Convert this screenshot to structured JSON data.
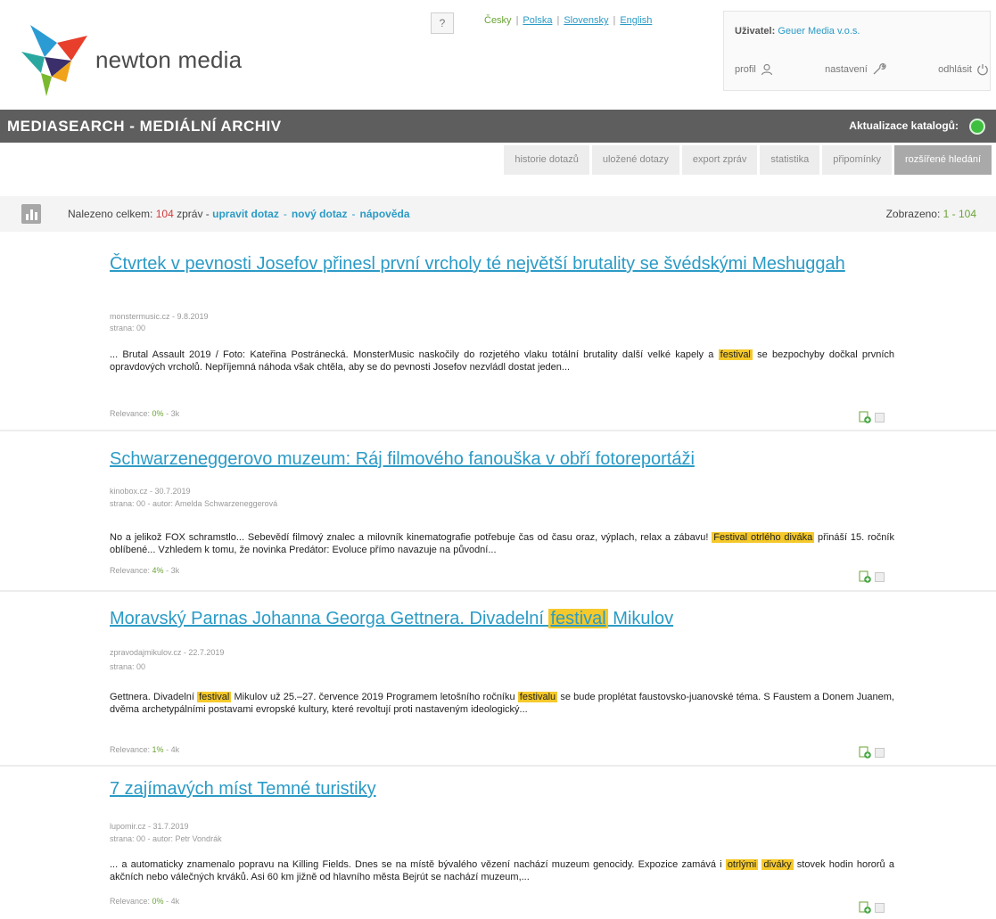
{
  "brand": {
    "name": "newton media"
  },
  "header": {
    "help_label": "?",
    "languages": [
      {
        "label": "Česky",
        "active": true
      },
      {
        "label": "Polska",
        "active": false
      },
      {
        "label": "Slovensky",
        "active": false
      },
      {
        "label": "English",
        "active": false
      }
    ],
    "user": {
      "label": "Uživatel:",
      "value": "Geuer Media v.o.s.",
      "profile_label": "profil",
      "settings_label": "nastavení",
      "logout_label": "odhlásit"
    }
  },
  "titlebar": {
    "title": "MEDIASEARCH - MEDIÁLNÍ ARCHIV",
    "catalog_label": "Aktualizace katalogů:",
    "status_color": "#3fbf3f"
  },
  "tabs": [
    {
      "label": "historie dotazů",
      "active": false
    },
    {
      "label": "uložené dotazy",
      "active": false
    },
    {
      "label": "export zpráv",
      "active": false
    },
    {
      "label": "statistika",
      "active": false
    },
    {
      "label": "připomínky",
      "active": false
    },
    {
      "label": "rozšířené hledání",
      "active": true
    }
  ],
  "infobar": {
    "found_prefix": "Nalezeno celkem:",
    "found_count": "104",
    "found_suffix": "zpráv -",
    "edit_query": "upravit dotaz",
    "new_query": "nový dotaz",
    "help": "nápověda",
    "shown_label": "Zobrazeno:",
    "shown_range": "1 - 104"
  },
  "results": [
    {
      "title": "Čtvrtek v pevnosti Josefov přinesl první vrcholy té největší brutality se švédskými Meshuggah",
      "source": "monstermusic.cz - 9.8.2019",
      "details": "strana: 00",
      "snippet_parts": [
        {
          "text": "... Brutal Assault 2019 / Foto: Kateřina Postránecká. MonsterMusic naskočily do rozjetého vlaku totální brutality další velké kapely a ",
          "hl": false
        },
        {
          "text": "festival",
          "hl": true
        },
        {
          "text": " se bezpochyby dočkal prvních opravdových vrcholů. Nepříjemná náhoda však chtěla, aby se do pevnosti Josefov nezvládl dostat jeden...",
          "hl": false
        }
      ],
      "relevance_label": "Relevance:",
      "relevance_value": "0%",
      "relevance_suffix": "- 3k"
    },
    {
      "title": "Schwarzeneggerovo muzeum: Ráj filmového fanouška v obří fotoreportáži",
      "source": "kinobox.cz - 30.7.2019",
      "details": "strana: 00 - autor: Amelda Schwarzeneggerová",
      "snippet_parts": [
        {
          "text": "No a jelikož FOX schramstlo... Sebevědí filmový znalec a milovník kinematografie potřebuje čas od času oraz, výplach, relax a zábavu! ",
          "hl": false
        },
        {
          "text": "Festival otrlého diváka",
          "hl": true
        },
        {
          "text": " přináší 15. ročník oblíbené... Vzhledem k tomu, že novinka Predátor: Evoluce přímo navazuje na původní...",
          "hl": false
        }
      ],
      "relevance_label": "Relevance:",
      "relevance_value": "4%",
      "relevance_suffix": "- 3k"
    },
    {
      "title_parts": [
        {
          "text": "Moravský Parnas Johanna Georga Gettnera. Divadelní ",
          "hl": false
        },
        {
          "text": "festival",
          "hl": true
        },
        {
          "text": " Mikulov",
          "hl": false
        }
      ],
      "source": "zpravodajmikulov.cz - 22.7.2019",
      "details": "strana: 00",
      "snippet_parts": [
        {
          "text": "Gettnera. Divadelní ",
          "hl": false
        },
        {
          "text": "festival",
          "hl": true
        },
        {
          "text": " Mikulov už 25.–27. července 2019 Programem letošního ročníku ",
          "hl": false
        },
        {
          "text": "festivalu",
          "hl": true
        },
        {
          "text": " se bude proplétat faustovsko-juanovské téma. S Faustem a Donem Juanem, dvěma archetypálními postavami evropské kultury, které revoltují proti nastaveným ideologický...",
          "hl": false
        }
      ],
      "relevance_label": "Relevance:",
      "relevance_value": "1%",
      "relevance_suffix": "- 4k"
    },
    {
      "title": "7 zajímavých míst Temné turistiky",
      "source": "lupomir.cz - 31.7.2019",
      "details": "strana: 00 - autor: Petr Vondrák",
      "snippet_parts": [
        {
          "text": "... a automaticky znamenalo popravu na Killing Fields. Dnes se na místě bývalého vězení nachází muzeum genocidy. Expozice zamává i ",
          "hl": false
        },
        {
          "text": "otrlými",
          "hl": true
        },
        {
          "text": " ",
          "hl": false
        },
        {
          "text": "diváky",
          "hl": true
        },
        {
          "text": " stovek hodin hororů a akčních nebo válečných krváků. Asi 60 km jižně od hlavního města Bejrút se nachází muzeum,...",
          "hl": false
        }
      ],
      "relevance_label": "Relevance:",
      "relevance_value": "0%",
      "relevance_suffix": "- 4k"
    }
  ]
}
